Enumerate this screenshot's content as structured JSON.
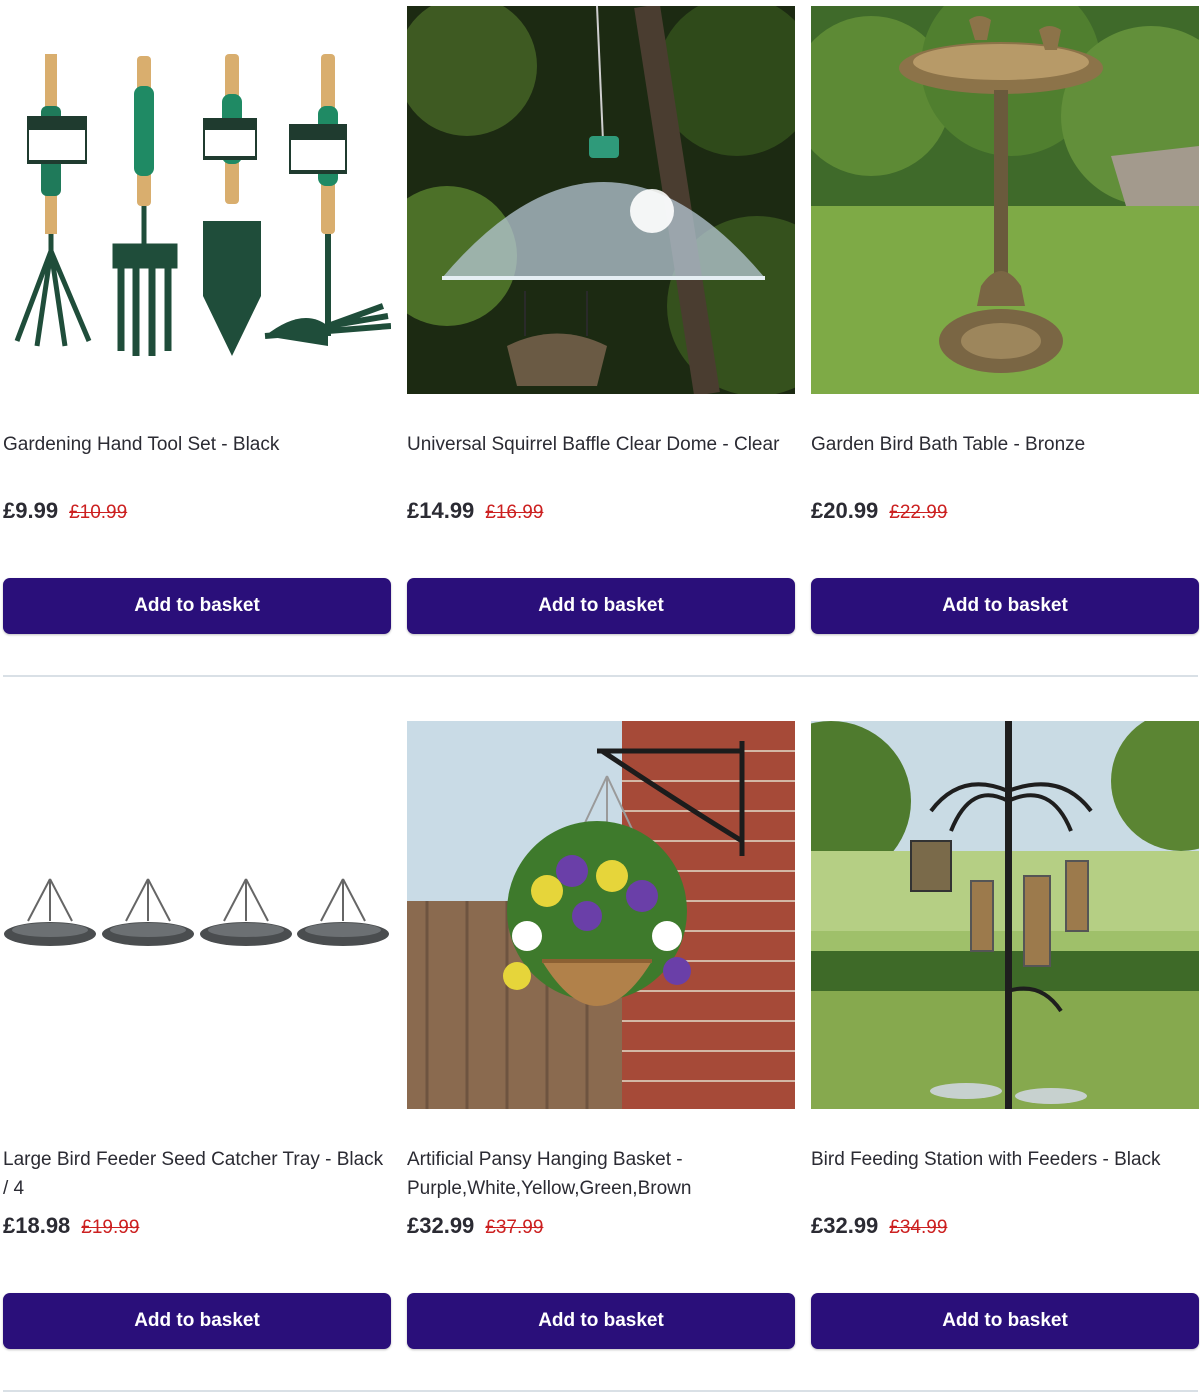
{
  "products": [
    {
      "title": "Gardening Hand Tool Set - Black",
      "price": "£9.99",
      "was": "£10.99",
      "button": "Add to basket",
      "image": "hand-tool-set-image"
    },
    {
      "title": "Universal Squirrel Baffle Clear Dome - Clear",
      "price": "£14.99",
      "was": "£16.99",
      "button": "Add to basket",
      "image": "squirrel-baffle-dome-image"
    },
    {
      "title": "Garden Bird Bath Table - Bronze",
      "price": "£20.99",
      "was": "£22.99",
      "button": "Add to basket",
      "image": "bird-bath-table-image"
    },
    {
      "title": "Large Bird Feeder Seed Catcher Tray - Black / 4",
      "price": "£18.98",
      "was": "£19.99",
      "button": "Add to basket",
      "image": "seed-catcher-tray-image"
    },
    {
      "title": "Artificial Pansy Hanging Basket - Purple,White,Yellow,Green,Brown",
      "price": "£32.99",
      "was": "£37.99",
      "button": "Add to basket",
      "image": "pansy-hanging-basket-image"
    },
    {
      "title": "Bird Feeding Station with Feeders - Black",
      "price": "£32.99",
      "was": "£34.99",
      "button": "Add to basket",
      "image": "bird-feeding-station-image"
    }
  ],
  "colors": {
    "button": "#2a0f7a",
    "sale_price": "#cc2020",
    "divider": "#d9e0e6"
  }
}
